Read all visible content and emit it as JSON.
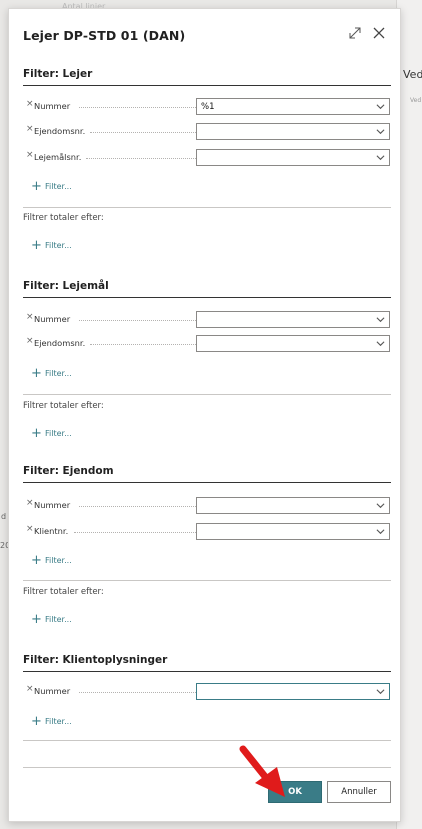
{
  "background": {
    "hint_text": "Antal linjer",
    "right_panel_text": "Ved",
    "right_panel_sub": "Ved",
    "left_snippet_1": "d",
    "left_snippet_2": "20"
  },
  "dialog": {
    "title": "Lejer DP-STD 01 (DAN)",
    "expand_icon": "expand-icon",
    "close_icon": "close-icon"
  },
  "sections": [
    {
      "title": "Filter: Lejer",
      "fields": [
        {
          "label": "Nummer",
          "value": "%1"
        },
        {
          "label": "Ejendomsnr.",
          "value": ""
        },
        {
          "label": "Lejemålsnr.",
          "value": ""
        }
      ],
      "add_filter": "Filter...",
      "totals_label": "Filtrer totaler efter:",
      "totals_add_filter": "Filter..."
    },
    {
      "title": "Filter: Lejemål",
      "fields": [
        {
          "label": "Nummer",
          "value": ""
        },
        {
          "label": "Ejendomsnr.",
          "value": ""
        }
      ],
      "add_filter": "Filter...",
      "totals_label": "Filtrer totaler efter:",
      "totals_add_filter": "Filter..."
    },
    {
      "title": "Filter: Ejendom",
      "fields": [
        {
          "label": "Nummer",
          "value": ""
        },
        {
          "label": "Klientnr.",
          "value": ""
        }
      ],
      "add_filter": "Filter...",
      "totals_label": "Filtrer totaler efter:",
      "totals_add_filter": "Filter..."
    },
    {
      "title": "Filter: Klientoplysninger",
      "fields": [
        {
          "label": "Nummer",
          "value": ""
        }
      ],
      "add_filter": "Filter..."
    }
  ],
  "buttons": {
    "ok": "OK",
    "cancel": "Annuller"
  },
  "colors": {
    "accent": "#3a7c87",
    "annotation_arrow": "#e01b1b"
  }
}
